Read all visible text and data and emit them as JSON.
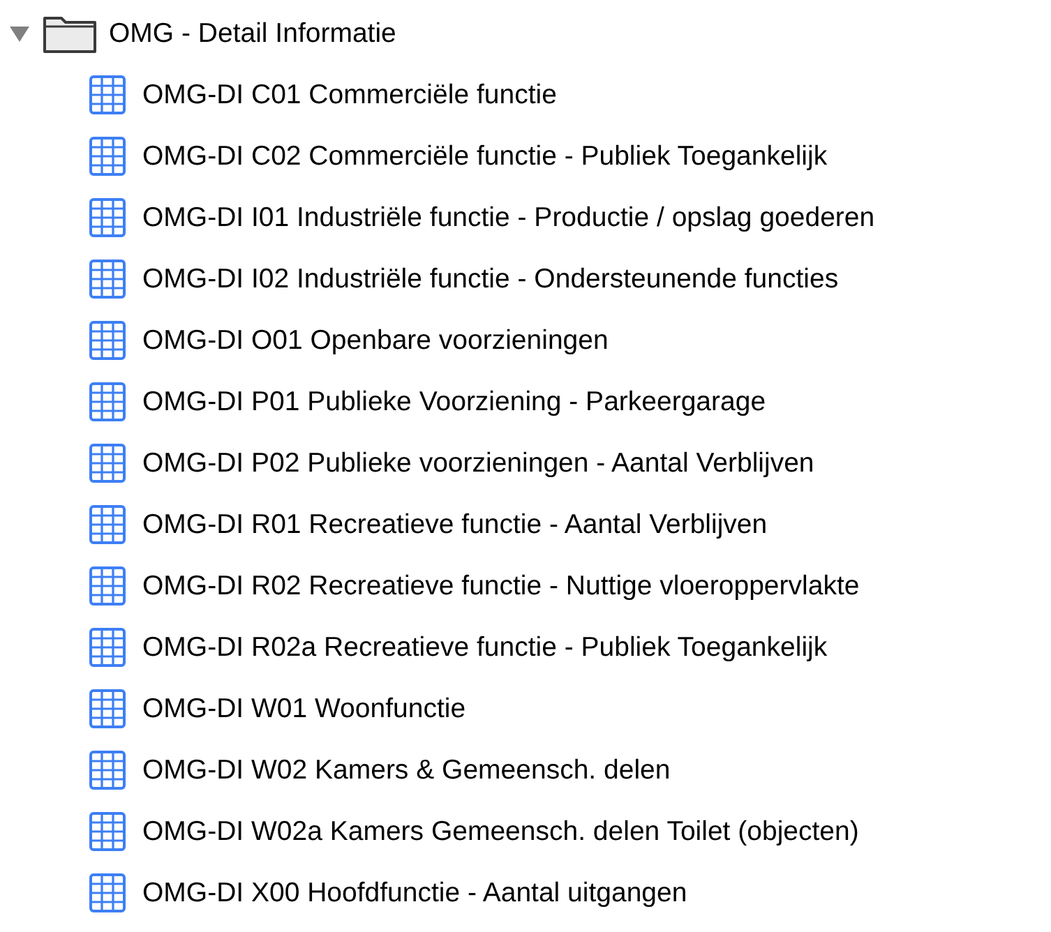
{
  "tree": [
    {
      "label": "OMG - Detail Informatie",
      "kind": "folder",
      "expanded": true,
      "children": [
        {
          "label": "OMG-DI C01 Commerciële functie",
          "kind": "table"
        },
        {
          "label": "OMG-DI C02 Commerciële functie - Publiek Toegankelijk",
          "kind": "table"
        },
        {
          "label": "OMG-DI I01 Industriële functie - Productie / opslag goederen",
          "kind": "table"
        },
        {
          "label": "OMG-DI I02 Industriële functie - Ondersteunende functies",
          "kind": "table"
        },
        {
          "label": "OMG-DI O01 Openbare voorzieningen",
          "kind": "table"
        },
        {
          "label": "OMG-DI P01 Publieke Voorziening - Parkeergarage",
          "kind": "table"
        },
        {
          "label": "OMG-DI P02 Publieke voorzieningen - Aantal Verblijven",
          "kind": "table"
        },
        {
          "label": "OMG-DI R01 Recreatieve functie - Aantal Verblijven",
          "kind": "table"
        },
        {
          "label": "OMG-DI R02 Recreatieve functie - Nuttige vloeroppervlakte",
          "kind": "table"
        },
        {
          "label": "OMG-DI R02a Recreatieve functie - Publiek Toegankelijk",
          "kind": "table"
        },
        {
          "label": "OMG-DI W01 Woonfunctie",
          "kind": "table"
        },
        {
          "label": "OMG-DI W02 Kamers & Gemeensch. delen",
          "kind": "table"
        },
        {
          "label": "OMG-DI W02a Kamers Gemeensch. delen Toilet (objecten)",
          "kind": "table"
        },
        {
          "label": "OMG-DI X00 Hoofdfunctie - Aantal uitgangen",
          "kind": "table"
        }
      ]
    }
  ]
}
